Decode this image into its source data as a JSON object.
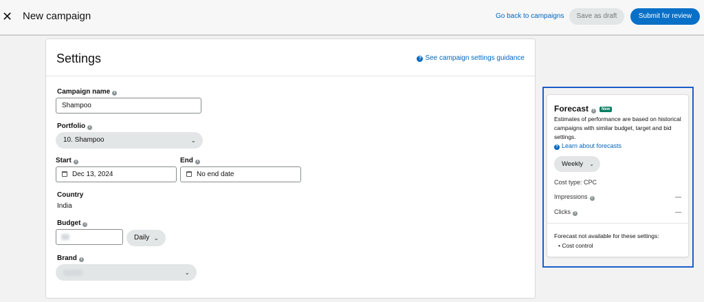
{
  "header": {
    "title": "New campaign",
    "close_icon": "close-icon",
    "back_link": "Go back to campaigns",
    "save_draft": "Save as draft",
    "submit": "Submit for review"
  },
  "settings": {
    "title": "Settings",
    "guidance_link": "See campaign settings guidance",
    "campaign_name": {
      "label": "Campaign name",
      "value": "Shampoo"
    },
    "portfolio": {
      "label": "Portfolio",
      "value": "10. Shampoo"
    },
    "start": {
      "label": "Start",
      "value": "Dec 13, 2024"
    },
    "end": {
      "label": "End",
      "value": "No end date"
    },
    "country": {
      "label": "Country",
      "value": "India"
    },
    "budget": {
      "label": "Budget",
      "period": "Daily"
    },
    "brand": {
      "label": "Brand"
    }
  },
  "forecast": {
    "title": "Forecast",
    "badge": "New",
    "description": "Estimates of performance are based on historical campaigns with similar budget, target and bid settings.",
    "learn_link": "Learn about forecasts",
    "period": "Weekly",
    "cost_type": "Cost type: CPC",
    "impressions_label": "Impressions",
    "impressions_value": "—",
    "clicks_label": "Clicks",
    "clicks_value": "—",
    "not_available": "Forecast not available for these settings:",
    "unavailable_item": "Cost control"
  },
  "colors": {
    "primary": "#0970c8",
    "link": "#0066c0",
    "highlight": "#1a5dc9",
    "badge": "#067d62"
  }
}
